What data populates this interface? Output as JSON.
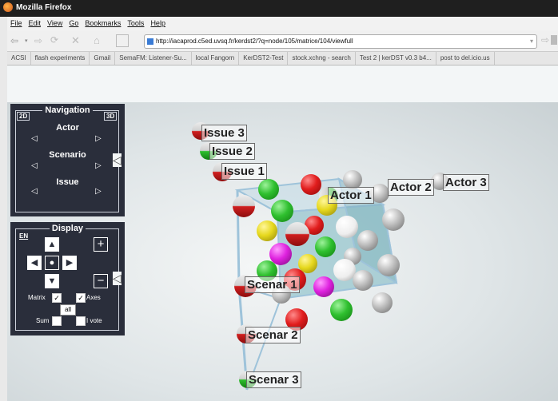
{
  "window": {
    "title": "Mozilla Firefox"
  },
  "menu": [
    "File",
    "Edit",
    "View",
    "Go",
    "Bookmarks",
    "Tools",
    "Help"
  ],
  "url": "http://iacaprod.c5ed.uvsq.fr/kerdst2/?q=node/105/matrice/104/viewfull",
  "bookmarks": [
    "ACSI",
    "flash experiments",
    "Gmail",
    "SemaFM: Listener-Su...",
    "local Fangorn",
    "KerDST2-Test",
    "stock.xchng - search",
    "Test 2 | kerDST v0.3 b4...",
    "post to del.icio.us"
  ],
  "navigation": {
    "title": "Navigation",
    "corner_left": "2D",
    "corner_right": "3D",
    "rows": [
      {
        "label": "Actor",
        "left": "◁",
        "right": "▷"
      },
      {
        "label": "Scenario",
        "left": "◁",
        "right": "▷"
      },
      {
        "label": "Issue",
        "left": "◁",
        "right": "▷"
      }
    ],
    "side_arrow": "◁"
  },
  "display": {
    "title": "Display",
    "corner_left": "EN",
    "plus": "+",
    "minus": "−",
    "side_arrow": "◁",
    "matrix_label": "Matrix",
    "axes_label": "Axes",
    "all_label": "all",
    "sum_label": "Sum",
    "ivote_label": "I vote",
    "matrix_checked": "✓",
    "axes_checked": "✓"
  },
  "scene": {
    "labels": {
      "issue1": "Issue 1",
      "issue2": "Issue 2",
      "issue3": "Issue 3",
      "actor1": "Actor 1",
      "actor2": "Actor 2",
      "actor3": "Actor 3",
      "scenar1": "Scenar 1",
      "scenar2": "Scenar 2",
      "scenar3": "Scenar 3"
    }
  }
}
